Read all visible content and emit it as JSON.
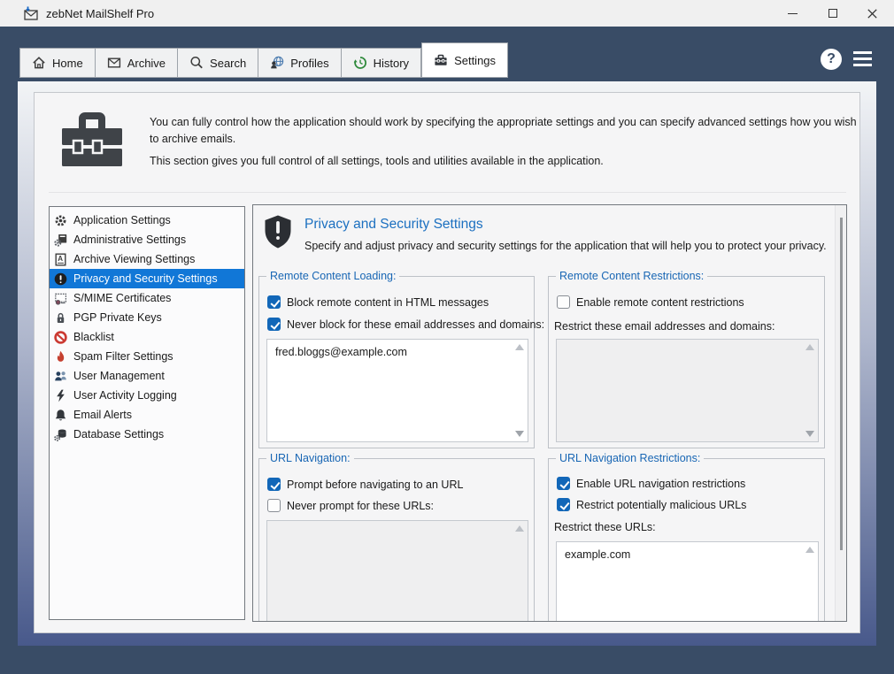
{
  "window": {
    "title": "zebNet MailShelf Pro"
  },
  "toolbar": {
    "help_glyph": "?"
  },
  "tabs": [
    {
      "label": "Home",
      "icon": "home-icon",
      "active": false
    },
    {
      "label": "Archive",
      "icon": "envelope-icon",
      "active": false
    },
    {
      "label": "Search",
      "icon": "search-icon",
      "active": false
    },
    {
      "label": "Profiles",
      "icon": "profiles-globe-icon",
      "active": false
    },
    {
      "label": "History",
      "icon": "history-icon",
      "active": false
    },
    {
      "label": "Settings",
      "icon": "toolbox-icon",
      "active": true
    }
  ],
  "intro": {
    "paragraph1": "You can fully control how the application should work by specifying the appropriate settings and you can specify advanced settings how you wish to archive emails.",
    "paragraph2": "This section gives you full control of all settings, tools and utilities available in the application."
  },
  "sidebar": {
    "items": [
      {
        "label": "Application Settings",
        "icon": "gear-icon",
        "selected": false
      },
      {
        "label": "Administrative Settings",
        "icon": "admin-gear-icon",
        "selected": false
      },
      {
        "label": "Archive Viewing Settings",
        "icon": "archive-document-icon",
        "selected": false
      },
      {
        "label": "Privacy and Security Settings",
        "icon": "alert-circle-icon",
        "selected": true
      },
      {
        "label": "S/MIME Certificates",
        "icon": "certificate-icon",
        "selected": false
      },
      {
        "label": "PGP Private Keys",
        "icon": "padlock-icon",
        "selected": false
      },
      {
        "label": "Blacklist",
        "icon": "block-icon",
        "selected": false
      },
      {
        "label": "Spam Filter Settings",
        "icon": "flame-icon",
        "selected": false
      },
      {
        "label": "User Management",
        "icon": "users-icon",
        "selected": false
      },
      {
        "label": "User Activity Logging",
        "icon": "lightning-icon",
        "selected": false
      },
      {
        "label": "Email Alerts",
        "icon": "bell-icon",
        "selected": false
      },
      {
        "label": "Database Settings",
        "icon": "database-gear-icon",
        "selected": false
      }
    ]
  },
  "panel": {
    "title": "Privacy and Security Settings",
    "subtitle": "Specify and adjust privacy and security settings for the application that will help you to protect your privacy.",
    "groups": {
      "remote_content_loading": {
        "title": "Remote Content Loading:",
        "cb1": {
          "label": "Block remote content in HTML messages",
          "checked": true
        },
        "cb2": {
          "label": "Never block for these email addresses and domains:",
          "checked": true
        },
        "list_value": "fred.bloggs@example.com"
      },
      "remote_content_restrictions": {
        "title": "Remote Content Restrictions:",
        "cb1": {
          "label": "Enable remote content restrictions",
          "checked": false
        },
        "field_label": "Restrict these email addresses and domains:",
        "list_value": ""
      },
      "url_navigation": {
        "title": "URL Navigation:",
        "cb1": {
          "label": "Prompt before navigating to an URL",
          "checked": true
        },
        "cb2": {
          "label": "Never prompt for these URLs:",
          "checked": false
        },
        "list_value": ""
      },
      "url_navigation_restrictions": {
        "title": "URL Navigation Restrictions:",
        "cb1": {
          "label": "Enable URL navigation restrictions",
          "checked": true
        },
        "cb2": {
          "label": "Restrict potentially malicious URLs",
          "checked": true
        },
        "field_label": "Restrict these URLs:",
        "list_value": "example.com"
      }
    }
  },
  "colors": {
    "selection_blue": "#1177D7",
    "group_label_blue": "#1866B4",
    "checkbox_blue": "#1267B8",
    "panel_title_blue": "#1C70C0",
    "dark_slate": "#394C66"
  }
}
